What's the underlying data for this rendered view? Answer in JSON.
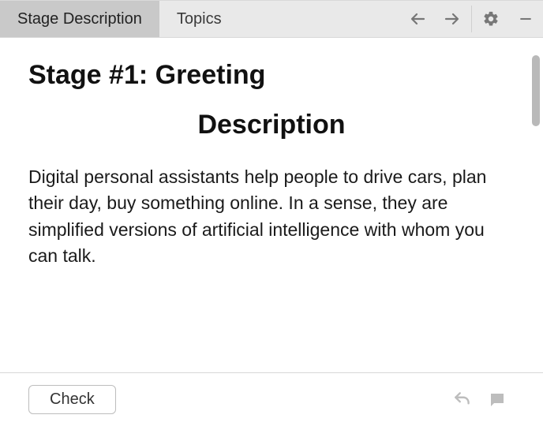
{
  "toolbar": {
    "tabs": [
      {
        "label": "Stage Description",
        "active": true
      },
      {
        "label": "Topics",
        "active": false
      }
    ],
    "icons": {
      "back": "arrow-left-icon",
      "forward": "arrow-right-icon",
      "settings": "gear-icon",
      "minimize": "minimize-icon"
    }
  },
  "content": {
    "stage_title": "Stage #1: Greeting",
    "subheading": "Description",
    "body": "Digital personal assistants help people to drive cars, plan their day, buy something online. In a sense, they are simplified versions of artificial intelligence with whom you can talk."
  },
  "footer": {
    "check_label": "Check",
    "icons": {
      "undo": "undo-icon",
      "comment": "comment-icon"
    }
  }
}
